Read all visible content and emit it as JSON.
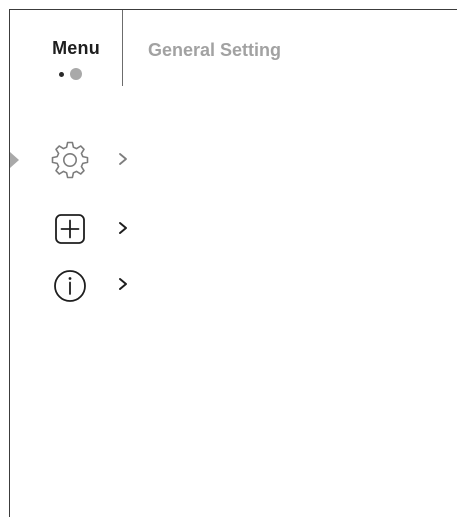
{
  "header": {
    "menu_label": "Menu",
    "section_title": "General Setting",
    "pagination": {
      "dots": [
        "small-dot",
        "large-dot"
      ]
    }
  },
  "menu": {
    "items": [
      {
        "icon": "gear-icon",
        "chevron": "chevron-right-icon",
        "selected": true,
        "state": "dimmed"
      },
      {
        "icon": "plus-box-icon",
        "chevron": "chevron-right-icon",
        "selected": false,
        "state": "normal"
      },
      {
        "icon": "info-circle-icon",
        "chevron": "chevron-right-icon",
        "selected": false,
        "state": "normal"
      }
    ]
  },
  "colors": {
    "text_primary": "#1e1e1e",
    "text_secondary": "#a2a2a2",
    "icon_dimmed": "#7d7d7d",
    "icon_normal": "#1e1e1e",
    "selector": "#a9a9a9",
    "border": "#3c3c3c"
  }
}
